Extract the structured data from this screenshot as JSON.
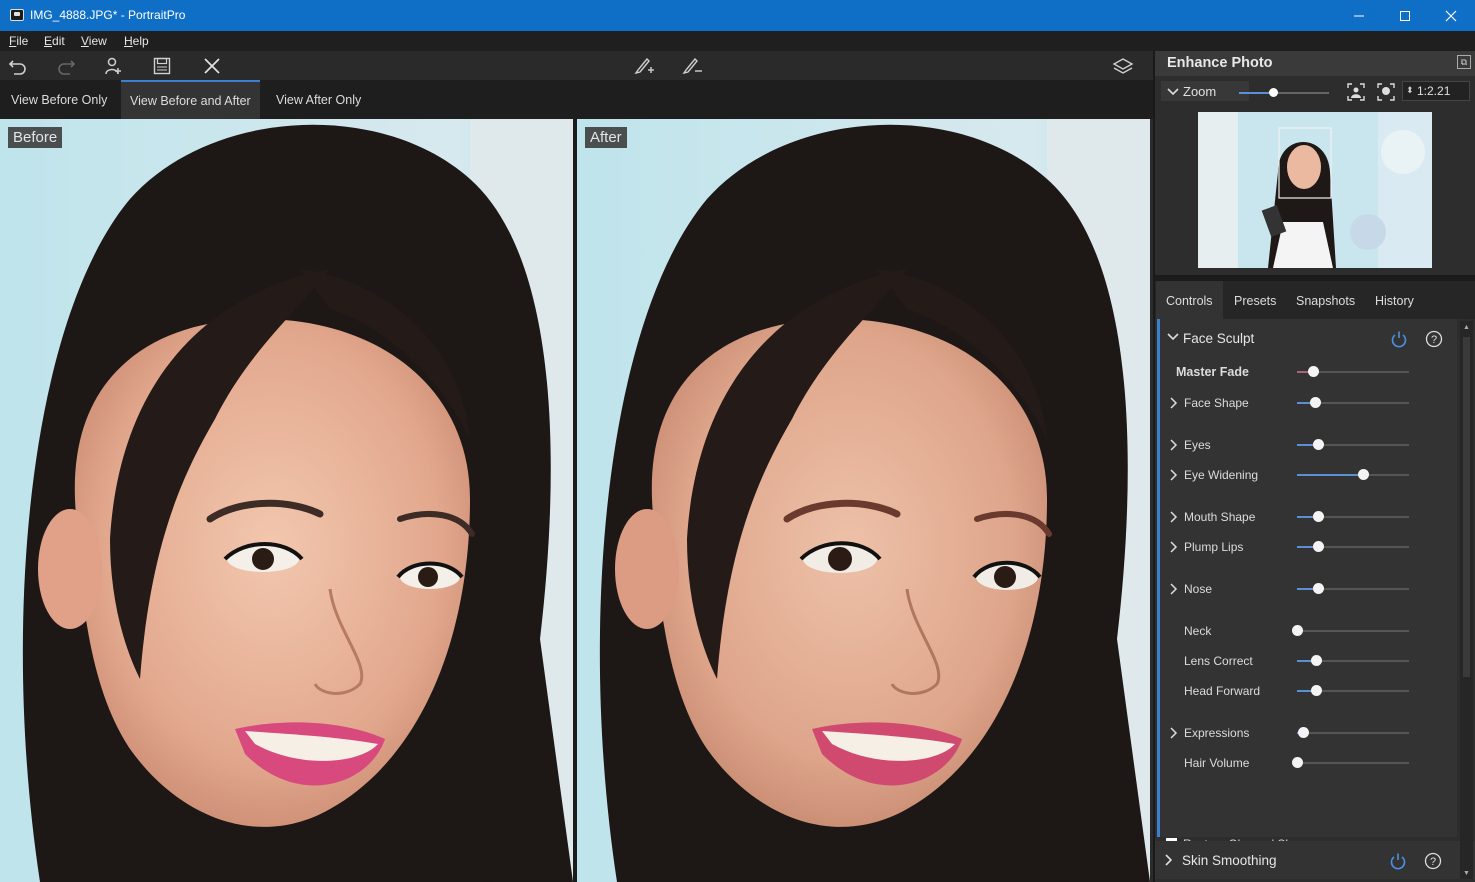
{
  "window": {
    "title": "IMG_4888.JPG* - PortraitPro",
    "minimize_icon": "minimize-icon",
    "maximize_icon": "maximize-icon",
    "close_icon": "close-icon"
  },
  "menu": {
    "items": [
      {
        "label": "File",
        "hotkey": "F",
        "rest": "ile"
      },
      {
        "label": "Edit",
        "hotkey": "E",
        "rest": "dit"
      },
      {
        "label": "View",
        "hotkey": "V",
        "rest": "iew"
      },
      {
        "label": "Help",
        "hotkey": "H",
        "rest": "elp"
      }
    ]
  },
  "toolbar": {
    "icons": [
      "undo-icon",
      "redo-icon",
      "add-person-icon",
      "save-icon",
      "close-icon",
      "brush-add-icon",
      "brush-subtract-icon",
      "layers-icon"
    ]
  },
  "view_tabs": {
    "tabs": [
      {
        "label": "View Before Only",
        "active": false
      },
      {
        "label": "View Before and After",
        "active": true
      },
      {
        "label": "View After Only",
        "active": false
      }
    ]
  },
  "panes": {
    "before_label": "Before",
    "after_label": "After"
  },
  "right_panel": {
    "title": "Enhance Photo",
    "zoom_label": "Zoom",
    "zoom_value": "1:2.21",
    "zoom_slider_fraction": 0.38,
    "tabs": [
      {
        "label": "Controls",
        "active": true
      },
      {
        "label": "Presets",
        "active": false
      },
      {
        "label": "Snapshots",
        "active": false
      },
      {
        "label": "History",
        "active": false
      }
    ],
    "face_sculpt": {
      "title": "Face Sculpt",
      "controls": [
        {
          "label": "Master Fade",
          "value": 0.14,
          "expandable": false,
          "bold": true,
          "fill_color": "#b0607a"
        },
        {
          "label": "Face Shape",
          "value": 0.16,
          "expandable": true
        },
        {
          "label": "Eyes",
          "value": 0.19,
          "expandable": true
        },
        {
          "label": "Eye Widening",
          "value": 0.59,
          "expandable": true
        },
        {
          "label": "Mouth Shape",
          "value": 0.19,
          "expandable": true
        },
        {
          "label": "Plump Lips",
          "value": 0.19,
          "expandable": true
        },
        {
          "label": "Nose",
          "value": 0.19,
          "expandable": true
        },
        {
          "label": "Neck",
          "value": 0.0,
          "expandable": false
        },
        {
          "label": "Lens Correct",
          "value": 0.17,
          "expandable": false
        },
        {
          "label": "Head Forward",
          "value": 0.17,
          "expandable": false
        },
        {
          "label": "Expressions",
          "value": 0.05,
          "expandable": true
        },
        {
          "label": "Hair Volume",
          "value": 0.0,
          "expandable": false
        }
      ],
      "restore_glasses_label": "Restore Glasses' Shape",
      "restore_glasses_checked": false
    },
    "skin_smoothing": {
      "title": "Skin Smoothing"
    }
  },
  "colors": {
    "titlebar": "#0f6fc6",
    "accent": "#3b7fcf",
    "slider_fill": "#5b8fd6"
  }
}
